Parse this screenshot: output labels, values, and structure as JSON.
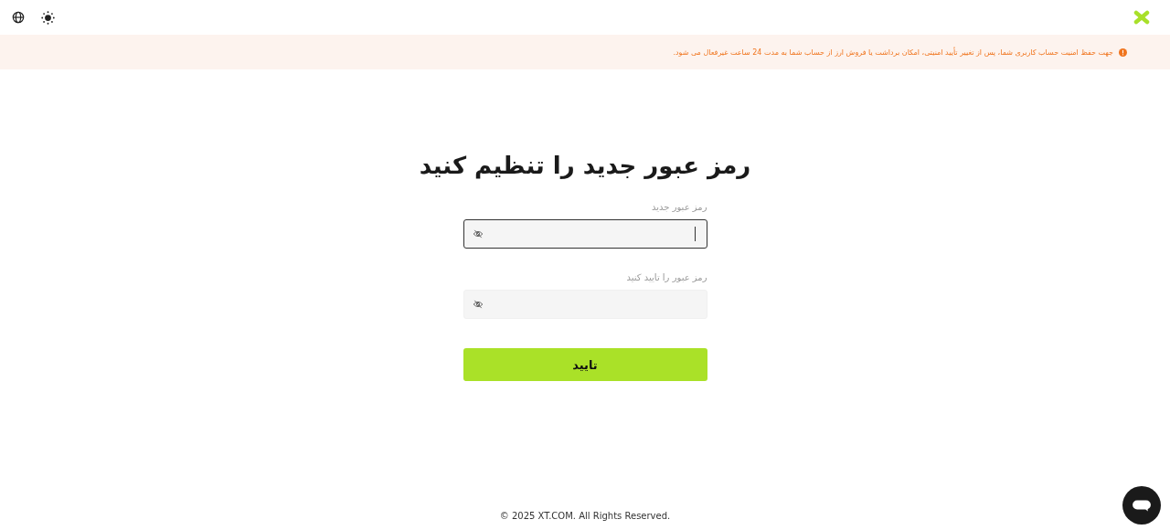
{
  "notice": {
    "text": "جهت حفظ امنیت حساب کاربری شما، پس از تغییر تأیید امنیتی، امکان برداشت یا فروش ارز از حساب شما به مدت 24 ساعت غیرفعال می شود."
  },
  "title": "رمز عبور جدید را تنظیم کنید",
  "fields": [
    {
      "label": "رمز عبور جدید",
      "focused": true
    },
    {
      "label": "رمز عبور را تایید کنید",
      "focused": false
    }
  ],
  "submit": "تایید",
  "footer": "© 2025 XT.COM. All Rights Reserved."
}
